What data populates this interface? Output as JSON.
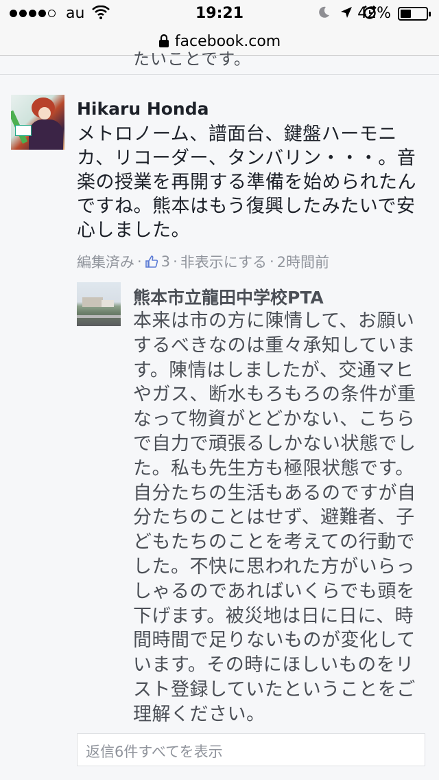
{
  "status_bar": {
    "carrier": "au",
    "time": "19:21",
    "battery_percent": "42%",
    "battery_level": 0.42,
    "signal_bars": 4,
    "icons": [
      "signal-dots-icon",
      "wifi-icon",
      "moon-icon",
      "location-arrow-icon",
      "alarm-icon",
      "battery-icon"
    ]
  },
  "browser": {
    "url": "facebook.com",
    "lock_icon": "lock-icon"
  },
  "clipped_previous_text": "たいことです。",
  "comment": {
    "author": "Hikaru Honda",
    "text": "メトロノーム、譜面台、鍵盤ハーモニカ、リコーダー、タンバリン・・・。音楽の授業を再開する準備を始められたんですね。熊本はもう復興したみたいで安心しました。",
    "meta": {
      "edited": "編集済み",
      "like_count": "3",
      "hide": "非表示にする",
      "time": "2時間前",
      "separator": "·"
    }
  },
  "reply": {
    "author": "熊本市立龍田中学校PTA",
    "text": "本来は市の方に陳情して、お願いするべきなのは重々承知しています。陳情はしましたが、交通マヒやガス、断水もろもろの条件が重なって物資がとどかない、こちらで自力で頑張るしかない状態でした。私も先生方も極限状態です。自分たちの生活もあるのですが自分たちのことはせず、避難者、子どもたちのことを考えての行動でした。不快に思われた方がいらっしゃるのであればいくらでも頭を下げます。被災地は日に日に、時間時間で足りないものが変化しています。その時にほしいものをリスト登録していたということをご理解ください。"
  },
  "view_replies_label": "返信6件すべてを表示",
  "colors": {
    "background": "#f6f7f9",
    "meta_text": "#90949c",
    "reply_text": "#4b4f56",
    "main_text": "#1d2129"
  }
}
